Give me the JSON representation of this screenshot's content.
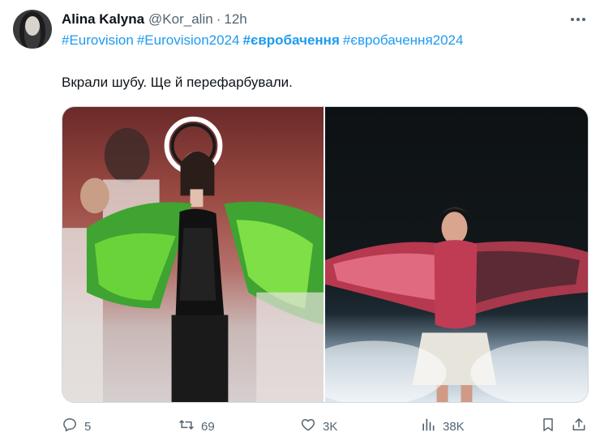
{
  "tweet": {
    "author_name": "Alina Kalyna",
    "handle": "@Kor_alin",
    "separator": "·",
    "time": "12h",
    "hashtags": [
      {
        "text": "#Eurovision",
        "bold": false
      },
      {
        "text": "#Eurovision2024",
        "bold": false
      },
      {
        "text": "#євробачення",
        "bold": true
      },
      {
        "text": "#євробачення2024",
        "bold": false
      }
    ],
    "text": "Вкрали шубу. Ще й перефарбували.",
    "actions": {
      "replies": "5",
      "retweets": "69",
      "likes": "3K",
      "views": "38K"
    }
  },
  "colors": {
    "link": "#1d9bf0",
    "secondary_text": "#536471",
    "primary_text": "#0f1419"
  },
  "icons": {
    "more": "more-dots-icon",
    "reply": "reply-icon",
    "retweet": "retweet-icon",
    "like": "heart-icon",
    "views": "views-bar-icon",
    "bookmark": "bookmark-icon",
    "share": "share-icon"
  }
}
